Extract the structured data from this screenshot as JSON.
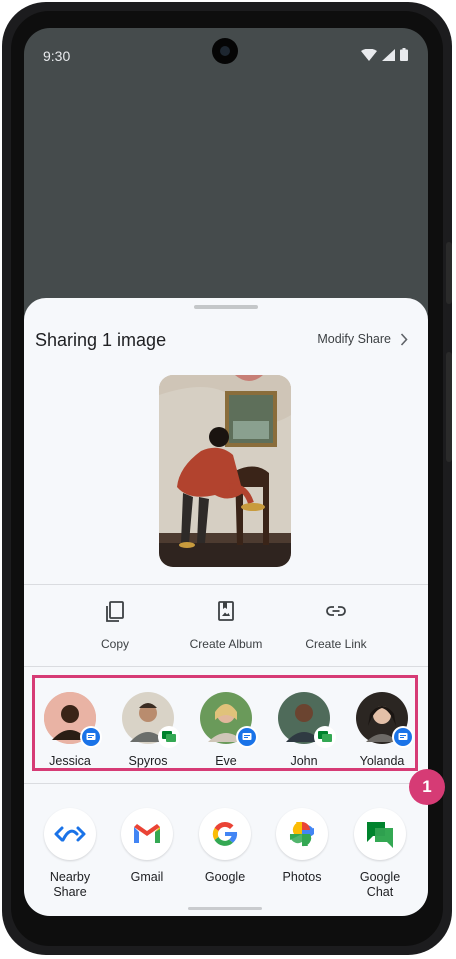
{
  "status_bar": {
    "time": "9:30"
  },
  "share_sheet": {
    "title": "Sharing 1 image",
    "modify_share": "Modify Share"
  },
  "actions": [
    {
      "label": "Copy",
      "icon": "copy-icon"
    },
    {
      "label": "Create Album",
      "icon": "album-icon"
    },
    {
      "label": "Create Link",
      "icon": "link-icon"
    }
  ],
  "contacts": [
    {
      "name": "Jessica",
      "badge": "messages-icon"
    },
    {
      "name": "Spyros",
      "badge": "chat-icon"
    },
    {
      "name": "Eve",
      "badge": "messages-icon"
    },
    {
      "name": "John",
      "badge": "chat-icon"
    },
    {
      "name": "Yolanda",
      "badge": "messages-icon"
    }
  ],
  "apps": [
    {
      "name": "Nearby\nShare",
      "icon": "nearby-share-icon"
    },
    {
      "name": "Gmail",
      "icon": "gmail-icon"
    },
    {
      "name": "Google",
      "icon": "google-icon"
    },
    {
      "name": "Photos",
      "icon": "photos-icon"
    },
    {
      "name": "Google\nChat",
      "icon": "google-chat-icon"
    }
  ],
  "annotation": {
    "number": "1"
  },
  "colors": {
    "highlight": "#d63b75",
    "sheet": "#f6f8fb",
    "backdrop": "#454b4c"
  }
}
